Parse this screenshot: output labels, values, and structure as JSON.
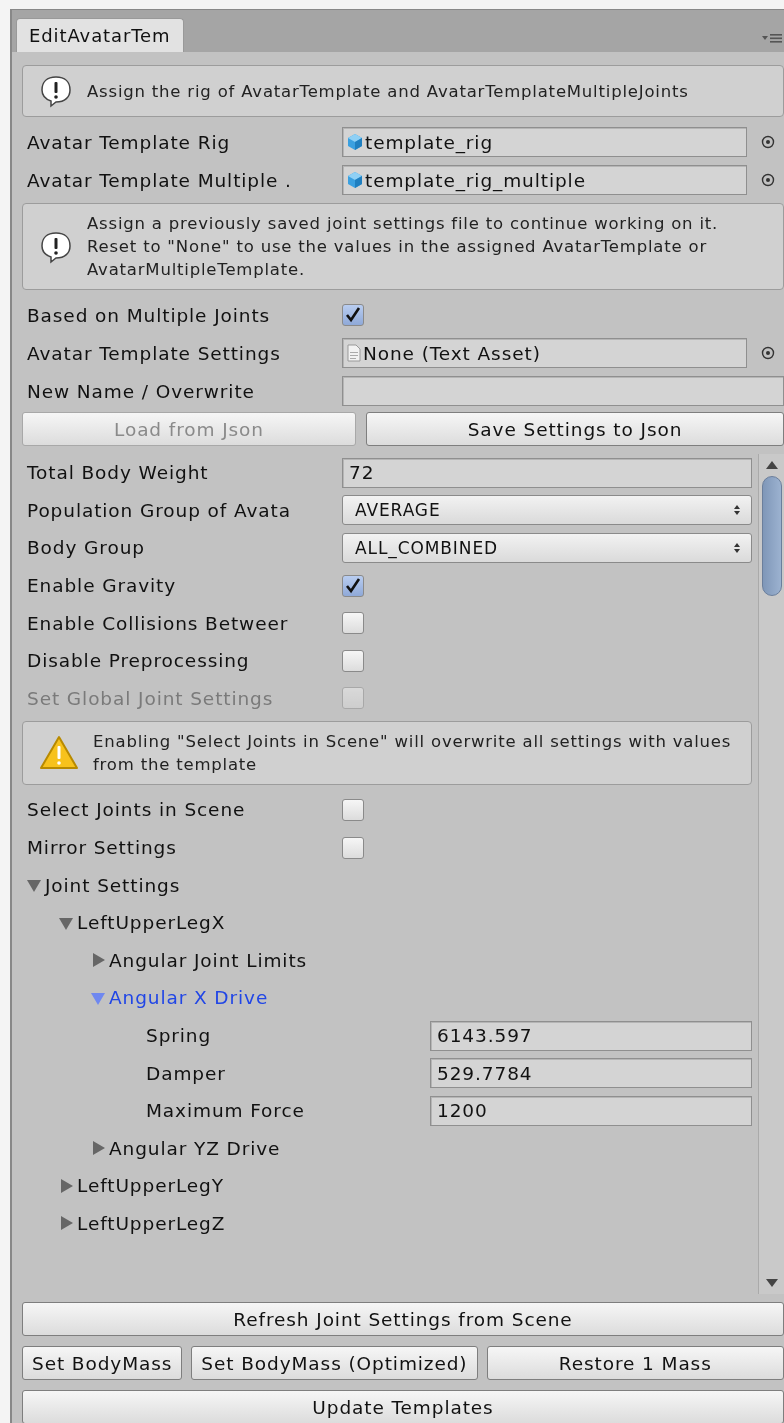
{
  "tab": {
    "label": "EditAvatarTem"
  },
  "top": [
    {
      "kind": "info",
      "text": "Assign the rig of AvatarTemplate and AvatarTemplateMultipleJoints"
    },
    {
      "kind": "prefab",
      "label": "Avatar Template Rig",
      "value": "template_rig"
    },
    {
      "kind": "prefab",
      "label": "Avatar Template Multiple .",
      "value": "template_rig_multiple"
    },
    {
      "kind": "info",
      "text": "Assign a previously saved joint settings file to continue working on it. Reset to \"None\" to use the values in the assigned AvatarTemplate or AvatarMultipleTemplate."
    },
    {
      "kind": "checkbox",
      "label": "Based on Multiple Joints",
      "checked": true,
      "disabled": false
    },
    {
      "kind": "textasset",
      "label": "Avatar Template Settings",
      "value": "None (Text Asset)"
    },
    {
      "kind": "text",
      "label": "New Name / Overwrite"
    },
    {
      "kind": "buttons",
      "buttons": [
        {
          "label": "Load from Json",
          "disabled": true
        },
        {
          "label": "Save Settings to Json",
          "disabled": false
        }
      ]
    }
  ],
  "scroll": [
    {
      "kind": "text",
      "label": "Total Body Weight",
      "value": "72"
    },
    {
      "kind": "dropdown",
      "label": "Population Group of Avata",
      "value": "AVERAGE"
    },
    {
      "kind": "dropdown",
      "label": "Body Group",
      "value": "ALL_COMBINED"
    },
    {
      "kind": "checkbox",
      "label": "Enable Gravity",
      "checked": true,
      "disabled": false
    },
    {
      "kind": "checkbox",
      "label": "Enable Collisions Betweer",
      "checked": false,
      "disabled": false
    },
    {
      "kind": "checkbox",
      "label": "Disable Preprocessing",
      "checked": false,
      "disabled": false
    },
    {
      "kind": "checkbox",
      "label": "Set Global Joint Settings",
      "checked": false,
      "disabled": true
    },
    {
      "kind": "warning",
      "text": "Enabling \"Select Joints in Scene\" will overwrite all settings with values from the template"
    },
    {
      "kind": "checkbox",
      "label": "Select Joints in Scene",
      "checked": false,
      "disabled": false
    },
    {
      "kind": "checkbox",
      "label": "Mirror Settings",
      "checked": false,
      "disabled": false
    }
  ],
  "tree": [
    {
      "label": "Joint Settings",
      "expanded": true,
      "selected": false,
      "children": [
        {
          "label": "LeftUpperLegX",
          "expanded": true,
          "selected": false,
          "children": [
            {
              "label": "Angular Joint Limits",
              "expanded": false,
              "selected": false
            },
            {
              "label": "Angular X Drive",
              "expanded": true,
              "selected": true,
              "fields": [
                {
                  "label": "Spring",
                  "value": "6143.597"
                },
                {
                  "label": "Damper",
                  "value": "529.7784"
                },
                {
                  "label": "Maximum Force",
                  "value": "1200"
                }
              ]
            },
            {
              "label": "Angular YZ Drive",
              "expanded": false,
              "selected": false
            }
          ]
        },
        {
          "label": "LeftUpperLegY",
          "expanded": false,
          "selected": false
        },
        {
          "label": "LeftUpperLegZ",
          "expanded": false,
          "selected": false
        }
      ]
    }
  ],
  "bottom_buttons": [
    [
      {
        "label": "Refresh Joint Settings from Scene"
      }
    ],
    [
      {
        "label": "Set BodyMass"
      },
      {
        "label": "Set BodyMass (Optimized)"
      },
      {
        "label": "Restore 1 Mass"
      }
    ],
    [
      {
        "label": "Update Templates"
      }
    ]
  ]
}
